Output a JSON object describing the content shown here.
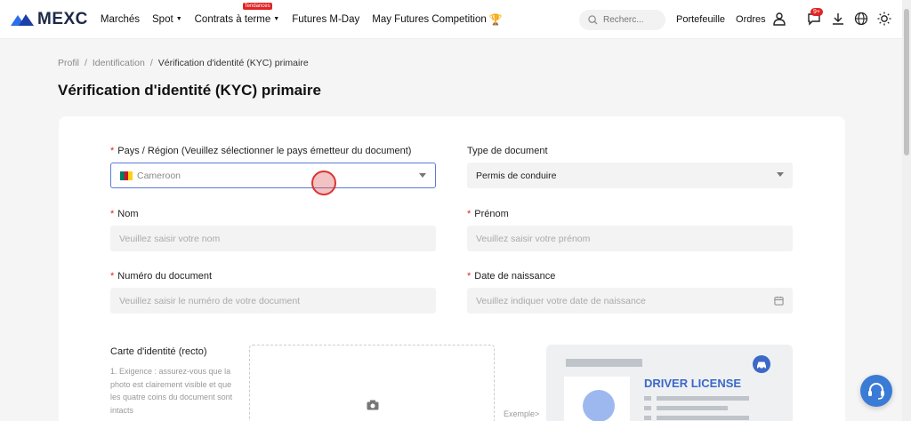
{
  "header": {
    "logo_text": "MEXC",
    "nav": [
      {
        "label": "Marchés",
        "dropdown": false
      },
      {
        "label": "Spot",
        "dropdown": true
      },
      {
        "label": "Contrats à terme",
        "dropdown": true,
        "badge": "Tendances"
      },
      {
        "label": "Futures M-Day",
        "dropdown": false
      },
      {
        "label": "May Futures Competition",
        "dropdown": false,
        "icon": "trophy-icon"
      }
    ],
    "search_placeholder": "Recherc...",
    "portfolio": "Portefeuille",
    "orders": "Ordres",
    "notifications_badge": "9+"
  },
  "breadcrumb": {
    "items": [
      "Profil",
      "Identification",
      "Vérification d'identité (KYC) primaire"
    ],
    "separator": "/"
  },
  "page_title": "Vérification d'identité (KYC) primaire",
  "form": {
    "country": {
      "label": "Pays / Région (Veuillez sélectionner le pays émetteur du document)",
      "value": "Cameroon",
      "required": true
    },
    "doc_type": {
      "label": "Type de document",
      "value": "Permis de conduire",
      "required": false
    },
    "last_name": {
      "label": "Nom",
      "placeholder": "Veuillez saisir votre nom",
      "required": true
    },
    "first_name": {
      "label": "Prénom",
      "placeholder": "Veuillez saisir votre prénom",
      "required": true
    },
    "doc_number": {
      "label": "Numéro du document",
      "placeholder": "Veuillez saisir le numéro de votre document",
      "required": true
    },
    "birth_date": {
      "label": "Date de naissance",
      "placeholder": "Veuillez indiquer votre date de naissance",
      "required": true
    },
    "required_mark": "*"
  },
  "upload": {
    "title": "Carte d'identité (recto)",
    "requirement": "1. Exigence : assurez-vous que la photo est clairement visible et que les quatre coins du document sont intacts",
    "example_label": "Exemple>",
    "sample_title": "DRIVER LICENSE"
  },
  "colors": {
    "accent": "#3b68c9",
    "required": "#e02424",
    "brand_blue": "#1c5ce0"
  }
}
